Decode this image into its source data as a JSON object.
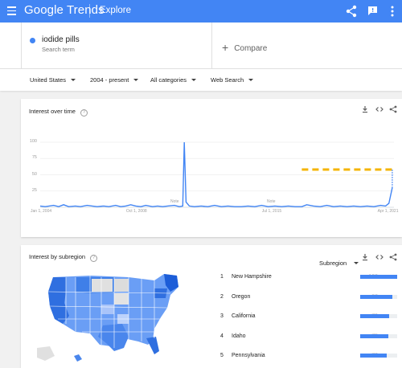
{
  "header": {
    "logo": "Google Trends",
    "breadcrumb": "Explore",
    "color": "#4285f4"
  },
  "search": {
    "term": "iodide pills",
    "term_type": "Search term",
    "compare_label": "Compare",
    "term_color": "#4285f4"
  },
  "filters": {
    "region": "United States",
    "period": "2004 - present",
    "category": "All categories",
    "property": "Web Search"
  },
  "interest_over_time": {
    "title": "Interest over time",
    "icons": [
      "download-icon",
      "embed-icon",
      "share-icon"
    ],
    "notes": [
      "Note",
      "Note"
    ],
    "chart_data": {
      "type": "line",
      "x_ticks": [
        "Jan 1, 2004",
        "Oct 1, 2008",
        "Jul 1, 2015",
        "Apr 1, 2021"
      ],
      "y_ticks": [
        100,
        75,
        50,
        25
      ],
      "ylim": [
        0,
        100
      ],
      "series": [
        {
          "color": "#4285f4",
          "x": [
            "2004-01",
            "2004-04",
            "2004-09",
            "2004-12",
            "2005-03",
            "2005-06",
            "2005-10",
            "2006-01",
            "2006-05",
            "2006-08",
            "2006-11",
            "2007-03",
            "2007-06",
            "2007-10",
            "2008-01",
            "2008-04",
            "2008-07",
            "2008-10",
            "2009-01",
            "2009-04",
            "2009-08",
            "2009-11",
            "2010-02",
            "2010-05",
            "2010-09",
            "2010-12",
            "2011-02",
            "2011-03",
            "2011-04",
            "2011-06",
            "2011-09",
            "2012-01",
            "2012-05",
            "2012-09",
            "2013-01",
            "2013-05",
            "2013-09",
            "2014-01",
            "2014-05",
            "2014-09",
            "2015-01",
            "2015-05",
            "2015-09",
            "2016-01",
            "2016-05",
            "2016-09",
            "2017-01",
            "2017-04",
            "2017-08",
            "2017-12",
            "2018-04",
            "2018-08",
            "2018-12",
            "2019-04",
            "2019-08",
            "2019-12",
            "2020-04",
            "2020-08",
            "2020-12",
            "2021-03",
            "2021-05",
            "2021-07"
          ],
          "y": [
            2,
            1,
            3,
            1,
            4,
            1,
            2,
            1,
            3,
            2,
            1,
            2,
            1,
            3,
            1,
            2,
            4,
            2,
            1,
            3,
            1,
            2,
            1,
            2,
            3,
            1,
            2,
            100,
            8,
            2,
            1,
            2,
            1,
            3,
            1,
            2,
            1,
            1,
            2,
            1,
            3,
            1,
            2,
            1,
            2,
            1,
            1,
            4,
            2,
            1,
            3,
            1,
            2,
            1,
            2,
            1,
            2,
            1,
            3,
            2,
            6,
            30
          ]
        },
        {
          "style": "forecast",
          "color": "#f4b400",
          "x": [
            "2017-01",
            "2021-07"
          ],
          "y": [
            58,
            58
          ]
        }
      ]
    }
  },
  "subregion": {
    "title": "Interest by subregion",
    "selector": "Subregion",
    "rows": [
      {
        "rank": "1",
        "name": "New Hampshire",
        "value": "100"
      },
      {
        "rank": "2",
        "name": "Oregon",
        "value": "86"
      },
      {
        "rank": "3",
        "name": "California",
        "value": "79"
      },
      {
        "rank": "4",
        "name": "Idaho",
        "value": "75"
      },
      {
        "rank": "5",
        "name": "Pennsylvania",
        "value": "72"
      }
    ]
  }
}
